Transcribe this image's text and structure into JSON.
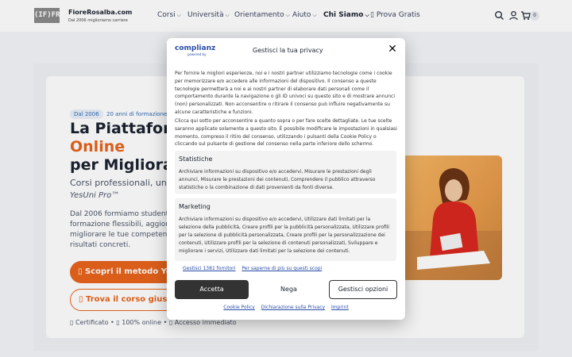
{
  "header": {
    "logo_mark": "(IF)FR",
    "site_name": "FioreRosalba.com",
    "tagline": "Dal 2006 miglioriamo carriere",
    "nav": [
      {
        "label": "Corsi"
      },
      {
        "label": "Università"
      },
      {
        "label": "Orientamento"
      },
      {
        "label": "Aiuto"
      },
      {
        "label": "Chi Siamo"
      },
      {
        "label": "Prova Gratis"
      }
    ],
    "cart_count": "0"
  },
  "hero": {
    "badge_year": "Dal 2006",
    "badge_experience": "20 anni di formazione e",
    "title_line1": "La Piattaforma",
    "title_line2": "Online",
    "title_line3": "per Migliorare",
    "subtitle": "Corsi professionali, universit",
    "subtitle2": "YesUni Pro™",
    "body": [
      "Dal 2006 formiamo studenti, la",
      "formazione flessibili, aggiornat",
      "migliorare le tue competenze e",
      "risultati concreti."
    ],
    "cta_primary": "▯ Scopri il metodo YesU",
    "cta_secondary": "▯ Trova il corso giusto",
    "trust_line": "▯ Certificato • ▯ 100% online • ▯ Accesso immediato"
  },
  "consent": {
    "brand": "complianz",
    "brand_sub": "powered by",
    "title": "Gestisci la tua privacy",
    "intro": "Per fornire le migliori esperienze, noi e i nostri partner utilizziamo tecnologie come i cookie per memorizzare e/o accedere alle informazioni del dispositivo. Il consenso a queste tecnologie permetterà a noi e ai nostri partner di elaborare dati personali come il comportamento durante la navigazione o gli ID univoci su questo sito e di mostrare annunci (non) personalizzati. Non acconsentire o ritirare il consenso può influire negativamente su alcune caratteristiche e funzioni.",
    "instructions": "Clicca qui sotto per acconsentire a quanto sopra o per fare scelte dettagliate. Le tue scelte saranno applicate solamente a questo sito. È possibile modificare le impostazioni in qualsiasi momento, compreso il ritiro del consenso, utilizzando i pulsanti della Cookie Policy o cliccando sul pulsante di gestione del consenso nella parte inferiore dello schermo.",
    "sections": [
      {
        "title": "Statistiche",
        "body": "Archiviare informazioni su dispositivo e/o accedervi, Misurare le prestazioni degli annunci, Misurare le prestazioni dei contenuti, Comprendere il pubblico attraverso statistiche o la combinazione di dati provenienti da fonti diverse."
      },
      {
        "title": "Marketing",
        "body": "Archiviare informazioni su dispositivo e/o accedervi, Utilizzare dati limitati per la selezione della pubblicità, Creare profili per la pubblicità personalizzata, Utilizzare profili per la selezione di pubblicità personalizzata, Creare profili per la personalizzazione dei contenuti, Utilizzare profili per la selezione di contenuti personalizzati, Sviluppare e migliorare i servizi, Utilizzare dati limitati per la selezione dei contenuti."
      }
    ],
    "link_vendors": "Gestisci 1381 fornitori",
    "link_purposes": "Per saperne di più su questi scopi",
    "accept": "Accetta",
    "deny": "Nega",
    "manage": "Gestisci opzioni",
    "footer": [
      "Cookie Policy",
      "Dichiarazione sulla Privacy",
      "Imprint"
    ]
  },
  "colors": {
    "accent": "#e8641c",
    "brand": "#2a4da8",
    "accept_bg": "#333333"
  }
}
